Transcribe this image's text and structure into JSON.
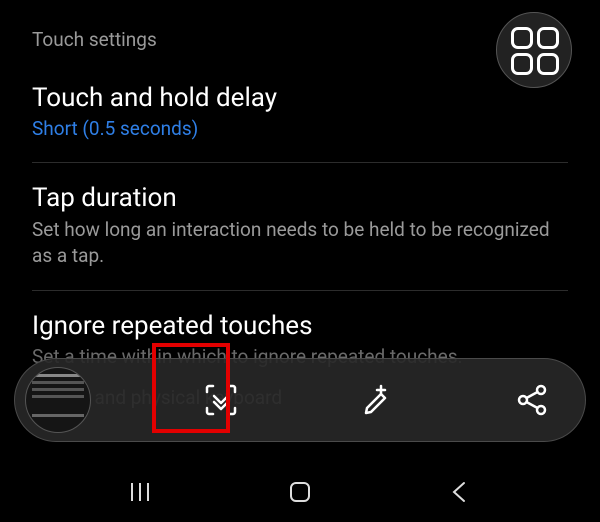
{
  "section_header": "Touch settings",
  "items": [
    {
      "title": "Touch and hold delay",
      "value": "Short (0.5 seconds)"
    },
    {
      "title": "Tap duration",
      "desc": "Set how long an interaction needs to be held to be recognized as a tap."
    },
    {
      "title": "Ignore repeated touches",
      "desc": "Set a time within which to ignore repeated touches."
    }
  ],
  "mouse_section": "Mouse and physical keyboard",
  "toolbar": {
    "thumbnail": "screenshot-thumbnail",
    "scroll_capture": "scroll-capture",
    "edit": "edit",
    "share": "share"
  },
  "floating": "apps-grid",
  "nav": {
    "recents": "recents",
    "home": "home",
    "back": "back"
  }
}
